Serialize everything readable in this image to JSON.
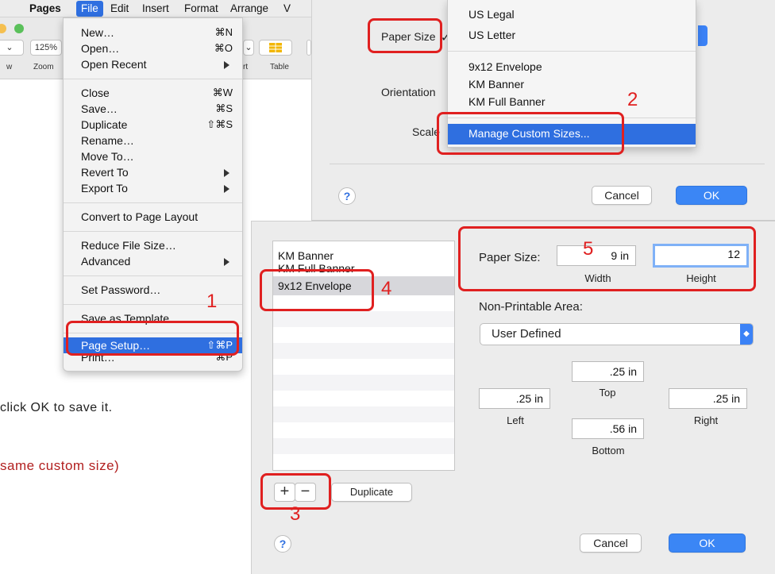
{
  "menubar": {
    "items": [
      "Pages",
      "File",
      "Edit",
      "Insert",
      "Format",
      "Arrange",
      "V"
    ]
  },
  "toolbar": {
    "view_label": "w",
    "zoom_value": "125%",
    "zoom_label": "Zoom",
    "partial_label": "rt",
    "table_label": "Table"
  },
  "file_menu": {
    "items": [
      {
        "label": "New…",
        "shortcut": "⌘N"
      },
      {
        "label": "Open…",
        "shortcut": "⌘O"
      },
      {
        "label": "Open Recent",
        "shortcut": ""
      },
      {
        "label": "Close",
        "shortcut": "⌘W"
      },
      {
        "label": "Save…",
        "shortcut": "⌘S"
      },
      {
        "label": "Duplicate",
        "shortcut": "⇧⌘S"
      },
      {
        "label": "Rename…",
        "shortcut": ""
      },
      {
        "label": "Move To…",
        "shortcut": ""
      },
      {
        "label": "Revert To",
        "shortcut": ""
      },
      {
        "label": "Export To",
        "shortcut": ""
      },
      {
        "label": "Convert to Page Layout",
        "shortcut": ""
      },
      {
        "label": "Reduce File Size…",
        "shortcut": ""
      },
      {
        "label": "Advanced",
        "shortcut": ""
      },
      {
        "label": "Set Password…",
        "shortcut": ""
      },
      {
        "label": "Save as Template…",
        "shortcut": ""
      },
      {
        "label": "Page Setup…",
        "shortcut": "⇧⌘P"
      },
      {
        "label": "Print…",
        "shortcut": "⌘P"
      }
    ]
  },
  "page_setup": {
    "paper_size_label": "Paper Size",
    "orientation_label": "Orientation",
    "scale_label": "Scale",
    "checkmark": "✓",
    "cancel": "Cancel",
    "ok": "OK",
    "help": "?"
  },
  "paper_menu": {
    "items": [
      "US Legal",
      "US Letter",
      "9x12 Envelope",
      "KM Banner",
      "KM Full Banner"
    ],
    "manage": "Manage Custom Sizes..."
  },
  "custom_sizes": {
    "list": [
      "KM Banner",
      "KM Full Banner",
      "9x12 Envelope"
    ],
    "add": "+",
    "remove": "−",
    "duplicate": "Duplicate",
    "paper_size_label": "Paper Size:",
    "width_value": "9 in",
    "height_value": "12",
    "width_caption": "Width",
    "height_caption": "Height",
    "non_printable_label": "Non-Printable Area:",
    "non_printable_value": "User Defined",
    "top_value": ".25 in",
    "top_caption": "Top",
    "left_value": ".25 in",
    "left_caption": "Left",
    "right_value": ".25 in",
    "right_caption": "Right",
    "bottom_value": ".56 in",
    "bottom_caption": "Bottom",
    "cancel": "Cancel",
    "ok": "OK",
    "help": "?"
  },
  "annotations": {
    "step1": "1",
    "step2": "2",
    "step3": "3",
    "step4": "4",
    "step5": "5"
  },
  "background_text": {
    "line1": "click OK to save it.",
    "line2": "same custom size)"
  },
  "colors": {
    "accent": "#2f6fe0",
    "annotation": "#e02020",
    "background_text_red": "#b22020"
  }
}
